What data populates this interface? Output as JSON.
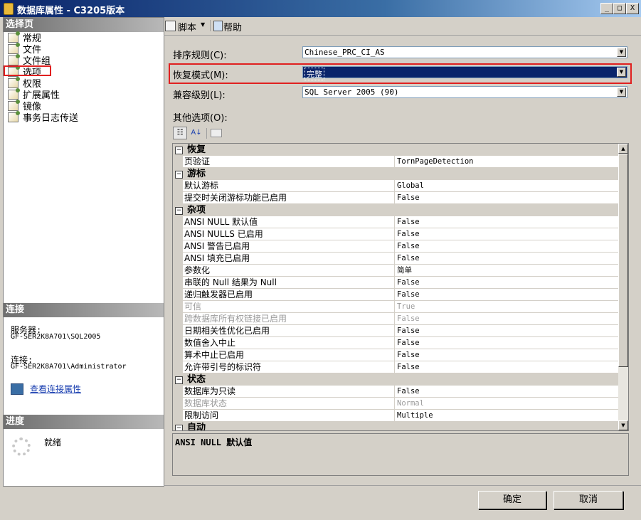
{
  "window": {
    "title": "数据库属性 - C3205版本",
    "minimize": "_",
    "maximize": "□",
    "close": "X"
  },
  "left": {
    "select_page_header": "选择页",
    "nav": [
      "常规",
      "文件",
      "文件组",
      "选项",
      "权限",
      "扩展属性",
      "镜像",
      "事务日志传送"
    ],
    "connection_header": "连接",
    "server_label": "服务器:",
    "server_value": "GF-SER2K8A701\\SQL2005",
    "conn_label": "连接:",
    "conn_value": "GF-SER2K8A701\\Administrator",
    "view_conn_link": "查看连接属性",
    "progress_header": "进度",
    "progress_status": "就绪"
  },
  "toolbar": {
    "script": "脚本",
    "help": "帮助"
  },
  "form": {
    "collation_label": "排序规则(C):",
    "collation_value": "Chinese_PRC_CI_AS",
    "recovery_label": "恢复模式(M):",
    "recovery_value": "完整",
    "compat_label": "兼容级别(L):",
    "compat_value": "SQL Server 2005 (90)",
    "other_label": "其他选项(O):"
  },
  "grid": {
    "rows": [
      {
        "kind": "cat",
        "name": "恢复"
      },
      {
        "kind": "prop",
        "name": "页验证",
        "value": "TornPageDetection"
      },
      {
        "kind": "cat",
        "name": "游标"
      },
      {
        "kind": "prop",
        "name": "默认游标",
        "value": "Global"
      },
      {
        "kind": "prop",
        "name": "提交时关闭游标功能已启用",
        "value": "False"
      },
      {
        "kind": "cat",
        "name": "杂项"
      },
      {
        "kind": "prop",
        "name": "ANSI NULL 默认值",
        "value": "False"
      },
      {
        "kind": "prop",
        "name": "ANSI NULLS 已启用",
        "value": "False"
      },
      {
        "kind": "prop",
        "name": "ANSI 警告已启用",
        "value": "False"
      },
      {
        "kind": "prop",
        "name": "ANSI 填充已启用",
        "value": "False"
      },
      {
        "kind": "prop",
        "name": "参数化",
        "value": "简单"
      },
      {
        "kind": "prop",
        "name": "串联的 Null 结果为 Null",
        "value": "False"
      },
      {
        "kind": "prop",
        "name": "递归触发器已启用",
        "value": "False"
      },
      {
        "kind": "prop",
        "name": "可信",
        "value": "True",
        "disabled": true
      },
      {
        "kind": "prop",
        "name": "跨数据库所有权链接已启用",
        "value": "False",
        "disabled": true
      },
      {
        "kind": "prop",
        "name": "日期相关性优化已启用",
        "value": "False"
      },
      {
        "kind": "prop",
        "name": "数值舍入中止",
        "value": "False"
      },
      {
        "kind": "prop",
        "name": "算术中止已启用",
        "value": "False"
      },
      {
        "kind": "prop",
        "name": "允许带引号的标识符",
        "value": "False"
      },
      {
        "kind": "cat",
        "name": "状态"
      },
      {
        "kind": "prop",
        "name": "数据库为只读",
        "value": "False"
      },
      {
        "kind": "prop",
        "name": "数据库状态",
        "value": "Normal",
        "disabled": true
      },
      {
        "kind": "prop",
        "name": "限制访问",
        "value": "Multiple"
      },
      {
        "kind": "cat",
        "name": "自动"
      }
    ],
    "description_title": "ANSI NULL 默认值"
  },
  "buttons": {
    "ok": "确定",
    "cancel": "取消"
  },
  "colors": {
    "highlight_border": "#e02020",
    "selection": "#0a246a"
  }
}
